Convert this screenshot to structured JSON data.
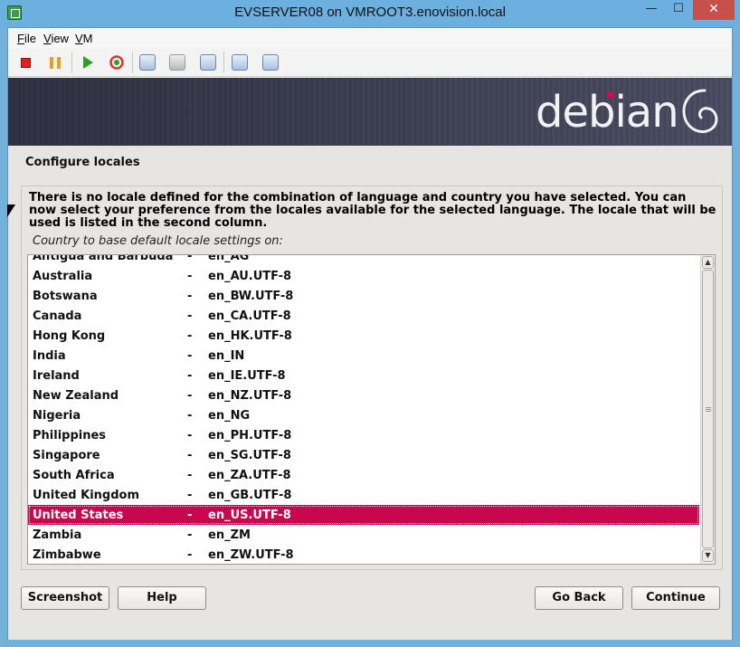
{
  "window": {
    "title": "EVSERVER08 on VMROOT3.enovision.local",
    "minimize_glyph": "—",
    "maximize_glyph": "☐",
    "close_glyph": "✕"
  },
  "menu": [
    "File",
    "View",
    "VM"
  ],
  "toolbar": {
    "icons": [
      "stop-icon",
      "pause-icon",
      "play-icon",
      "reset-icon",
      "snapshot-icon",
      "revert-snapshot-icon",
      "manage-snapshots-icon",
      "settings-icon",
      "tools-icon"
    ]
  },
  "installer": {
    "brand": "debian",
    "heading": "Configure locales",
    "description": "There is no locale defined for the combination of language and country you have selected. You can now select your preference from the locales available for the selected language. The locale that will be used is listed in the second column.",
    "prompt": "Country to base default locale settings on:",
    "separator": "-",
    "locales": [
      {
        "country": "Antigua and Barbuda",
        "locale": "en_AG"
      },
      {
        "country": "Australia",
        "locale": "en_AU.UTF-8"
      },
      {
        "country": "Botswana",
        "locale": "en_BW.UTF-8"
      },
      {
        "country": "Canada",
        "locale": "en_CA.UTF-8"
      },
      {
        "country": "Hong Kong",
        "locale": "en_HK.UTF-8"
      },
      {
        "country": "India",
        "locale": "en_IN"
      },
      {
        "country": "Ireland",
        "locale": "en_IE.UTF-8"
      },
      {
        "country": "New Zealand",
        "locale": "en_NZ.UTF-8"
      },
      {
        "country": "Nigeria",
        "locale": "en_NG"
      },
      {
        "country": "Philippines",
        "locale": "en_PH.UTF-8"
      },
      {
        "country": "Singapore",
        "locale": "en_SG.UTF-8"
      },
      {
        "country": "South Africa",
        "locale": "en_ZA.UTF-8"
      },
      {
        "country": "United Kingdom",
        "locale": "en_GB.UTF-8"
      },
      {
        "country": "United States",
        "locale": "en_US.UTF-8"
      },
      {
        "country": "Zambia",
        "locale": "en_ZM"
      },
      {
        "country": "Zimbabwe",
        "locale": "en_ZW.UTF-8"
      }
    ],
    "selected_country": "United States",
    "buttons": {
      "screenshot": "Screenshot",
      "help": "Help",
      "go_back": "Go Back",
      "continue": "Continue"
    },
    "selection_color": "#c9074f",
    "brand_accent": "#d70751"
  }
}
